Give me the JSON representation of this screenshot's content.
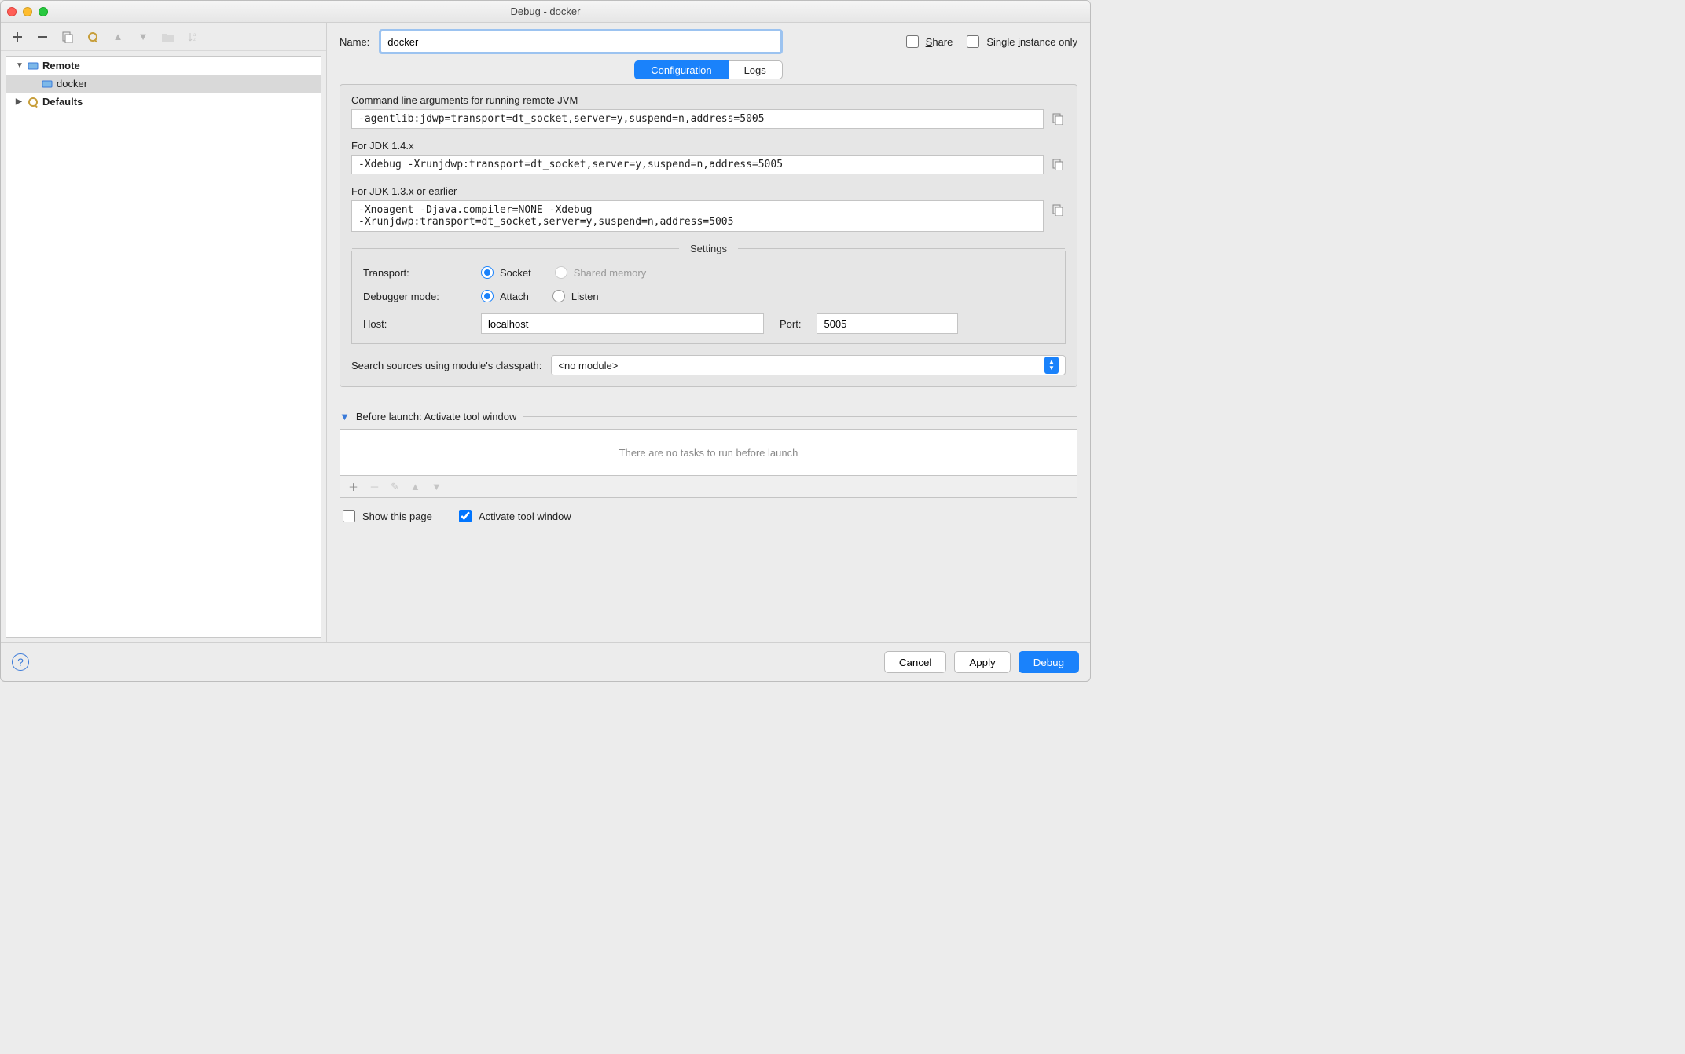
{
  "window": {
    "title": "Debug - docker"
  },
  "sidebar": {
    "toolbarIcons": [
      "add",
      "remove",
      "copy",
      "wrench",
      "up",
      "down",
      "folder",
      "sort"
    ],
    "items": [
      {
        "label": "Remote",
        "kind": "group",
        "expanded": true
      },
      {
        "label": "docker",
        "kind": "config",
        "selected": true
      },
      {
        "label": "Defaults",
        "kind": "group",
        "expanded": false
      }
    ]
  },
  "header": {
    "nameLabel": "Name:",
    "nameValue": "docker",
    "shareLabel": "Share",
    "singleInstanceLabel": "Single instance only",
    "shareChecked": false,
    "singleInstanceChecked": false
  },
  "tabs": {
    "configuration": "Configuration",
    "logs": "Logs",
    "active": "configuration"
  },
  "config": {
    "cmdLineLabel": "Command line arguments for running remote JVM",
    "cmdLineValue": "-agentlib:jdwp=transport=dt_socket,server=y,suspend=n,address=5005",
    "jdk14Label": "For JDK 1.4.x",
    "jdk14Value": "-Xdebug -Xrunjdwp:transport=dt_socket,server=y,suspend=n,address=5005",
    "jdk13Label": "For JDK 1.3.x or earlier",
    "jdk13Value": "-Xnoagent -Djava.compiler=NONE -Xdebug\n-Xrunjdwp:transport=dt_socket,server=y,suspend=n,address=5005",
    "settingsLabel": "Settings",
    "transportLabel": "Transport:",
    "transportSocket": "Socket",
    "transportShared": "Shared memory",
    "debuggerModeLabel": "Debugger mode:",
    "modeAttach": "Attach",
    "modeListen": "Listen",
    "hostLabel": "Host:",
    "hostValue": "localhost",
    "portLabel": "Port:",
    "portValue": "5005",
    "classpathLabel": "Search sources using module's classpath:",
    "classpathValue": "<no module>"
  },
  "beforeLaunch": {
    "title": "Before launch: Activate tool window",
    "emptyText": "There are no tasks to run before launch",
    "showThisPageLabel": "Show this page",
    "activateLabel": "Activate tool window",
    "showThisPageChecked": false,
    "activateChecked": true
  },
  "footer": {
    "cancel": "Cancel",
    "apply": "Apply",
    "debug": "Debug"
  }
}
